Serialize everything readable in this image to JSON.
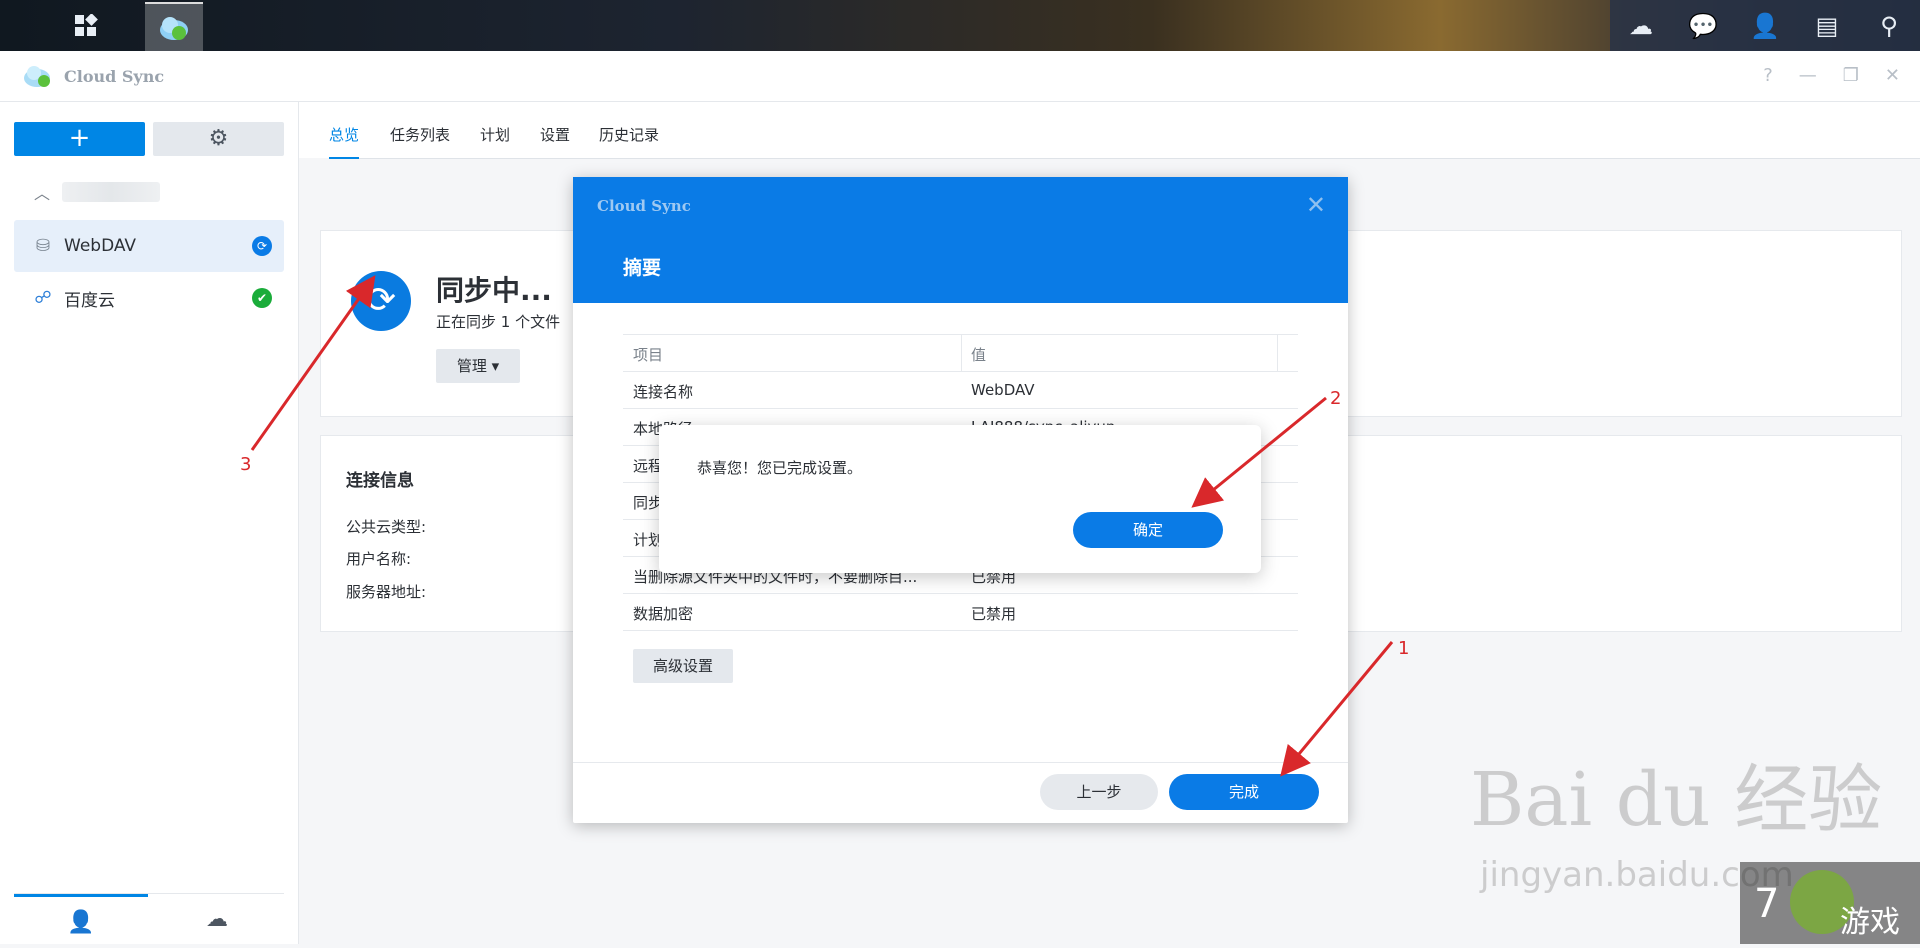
{
  "app": {
    "title": "Cloud Sync",
    "window_controls": [
      "?",
      "—",
      "❐",
      "✕"
    ]
  },
  "sidebar": {
    "add_label": "+",
    "gear_icon": "gear-icon",
    "items": [
      {
        "label": "WebDAV",
        "status": "syncing",
        "selected": true
      },
      {
        "label": "百度云",
        "status": "ok",
        "selected": false
      }
    ]
  },
  "tabs": [
    "总览",
    "任务列表",
    "计划",
    "设置",
    "历史记录"
  ],
  "overview": {
    "status_title": "同步中...",
    "status_sub": "正在同步 1 个文件",
    "manage_label": "管理 ▾"
  },
  "connection": {
    "title": "连接信息",
    "rows": [
      "公共云类型:",
      "用户名称:",
      "服务器地址:"
    ]
  },
  "dialog": {
    "app_title": "Cloud Sync",
    "title": "摘要",
    "headers": [
      "项目",
      "值"
    ],
    "rows": [
      {
        "k": "连接名称",
        "v": "WebDAV"
      },
      {
        "k": "本地路径",
        "v": "LAI888/sync_aliyun"
      },
      {
        "k": "远程路径",
        "v": ""
      },
      {
        "k": "同步方向",
        "v": ""
      },
      {
        "k": "计划",
        "v": ""
      },
      {
        "k": "当删除源文件夹中的文件时，不要删除目...",
        "v": "已禁用"
      },
      {
        "k": "数据加密",
        "v": "已禁用"
      }
    ],
    "advanced_label": "高级设置",
    "prev_label": "上一步",
    "done_label": "完成"
  },
  "message": {
    "text": "恭喜您！您已完成设置。",
    "ok_label": "确定"
  },
  "annotations": [
    "1",
    "2",
    "3"
  ],
  "watermark": {
    "main": "Bai du 经验",
    "sub": "jingyan.baidu.com"
  },
  "colors": {
    "accent": "#0a7be6",
    "annotation": "#d9282b",
    "sync_ok": "#1aac3a"
  }
}
